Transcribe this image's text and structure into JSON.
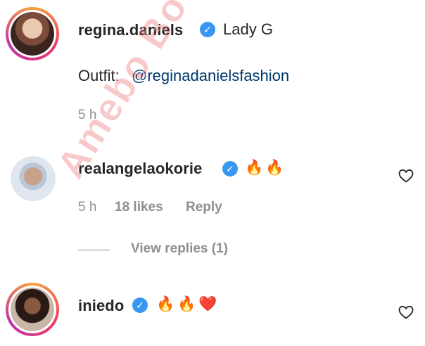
{
  "comments": [
    {
      "username": "regina.daniels",
      "verified": true,
      "text": "Lady G",
      "line2_label": "Outfit:",
      "line2_mention": "@reginadanielsfashion",
      "time": "5 h",
      "story_ring": true
    },
    {
      "username": "realangelaokorie",
      "verified": true,
      "emojis": [
        "🔥",
        "🔥"
      ],
      "time": "5 h",
      "likes": "18 likes",
      "reply": "Reply",
      "view_replies": "View replies (1)"
    },
    {
      "username": "iniedo",
      "verified": true,
      "emojis": [
        "🔥",
        "🔥",
        "❤️"
      ],
      "story_ring": true
    }
  ],
  "watermark": "Amebo Book",
  "colors": {
    "verified": "#3897f0",
    "mention": "#00376b",
    "meta": "#8e8e8e"
  }
}
